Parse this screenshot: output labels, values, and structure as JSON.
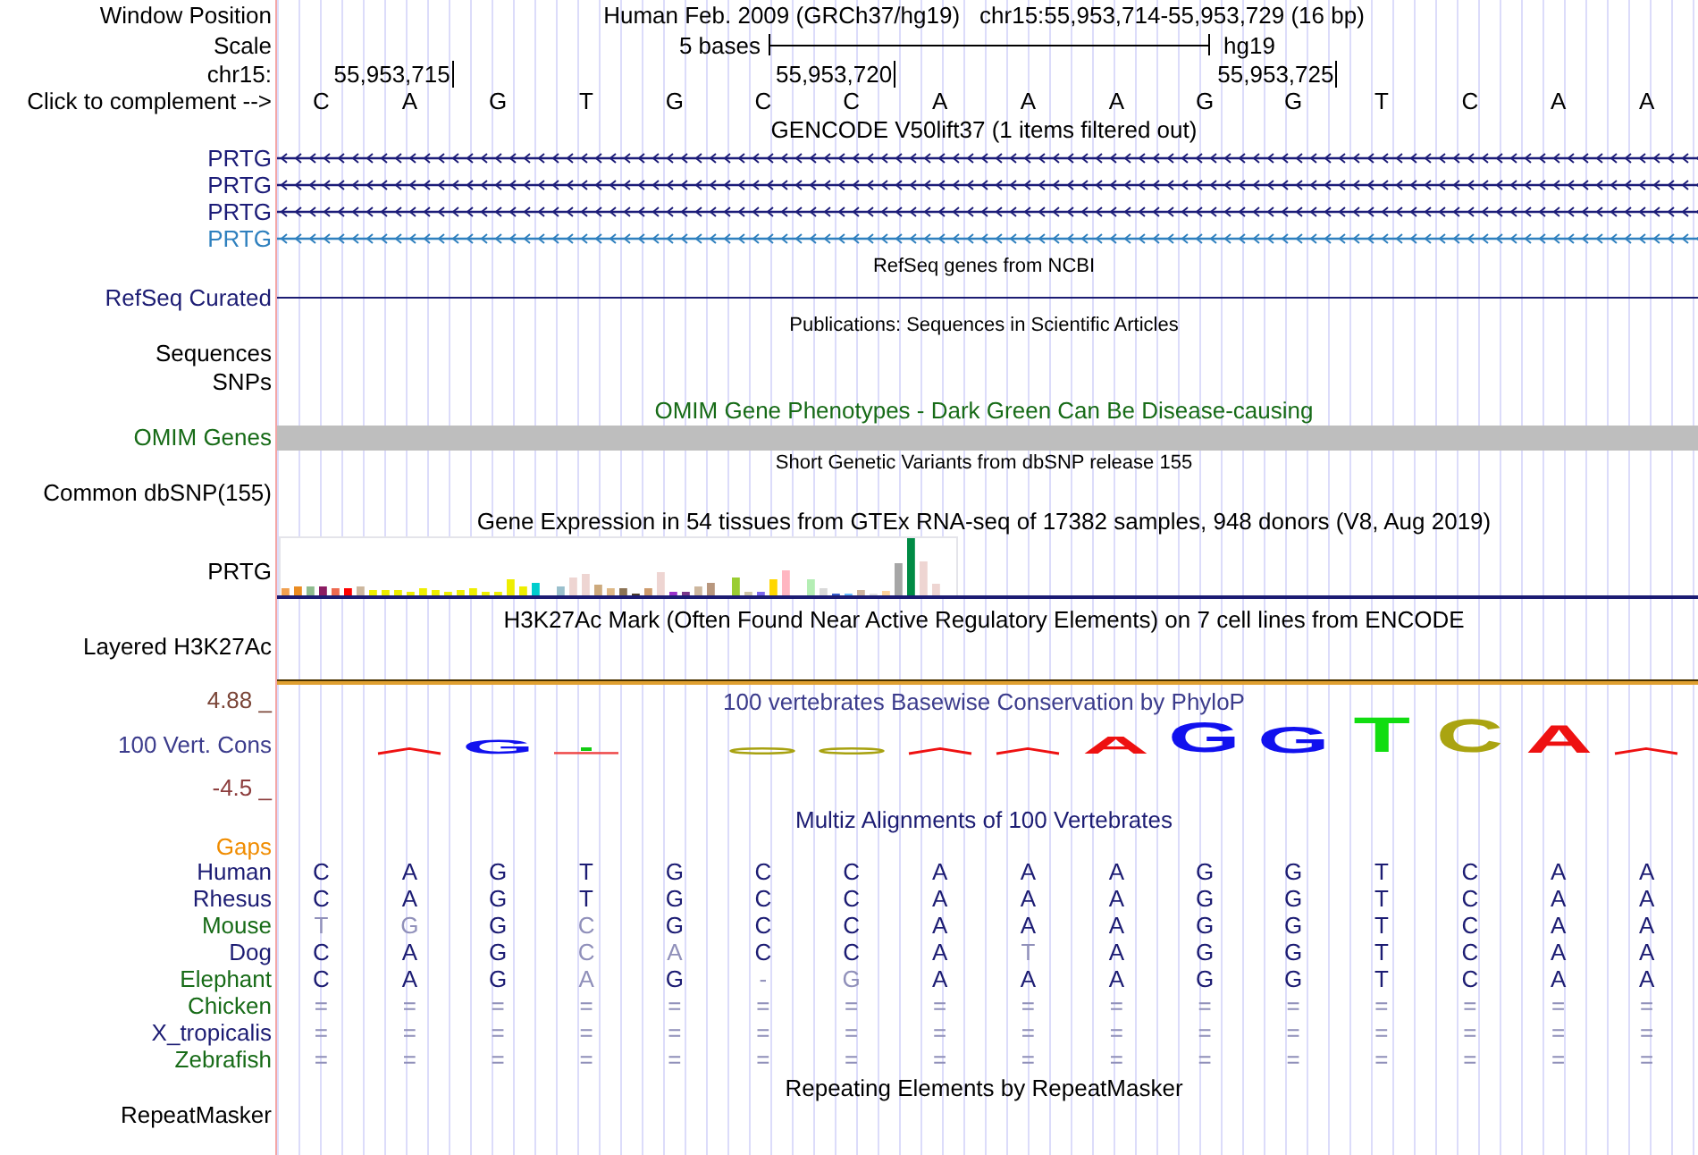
{
  "position_row": {
    "label": "Window Position",
    "titles": [
      "Human Feb. 2009 (GRCh37/hg19)",
      "chr15:55,953,714-55,953,729 (16 bp)"
    ]
  },
  "scale_row": {
    "label": "Scale",
    "span": "5 bases",
    "assembly": "hg19"
  },
  "coordinate_row": {
    "label": "chr15:",
    "positions": [
      "55,953,715",
      "55,953,720",
      "55,953,725"
    ]
  },
  "sequence_row": {
    "label": "Click to complement -->",
    "bases": [
      "C",
      "A",
      "G",
      "T",
      "G",
      "C",
      "C",
      "A",
      "A",
      "A",
      "G",
      "G",
      "T",
      "C",
      "A",
      "A"
    ]
  },
  "gencode": {
    "title": "GENCODE V50lift37 (1 items filtered out)",
    "transcripts": [
      {
        "label": "PRTG",
        "color": "#1c1c78"
      },
      {
        "label": "PRTG",
        "color": "#1c1c78"
      },
      {
        "label": "PRTG",
        "color": "#1c1c78"
      },
      {
        "label": "PRTG",
        "color": "#2f80be"
      }
    ]
  },
  "refseq": {
    "title": "RefSeq genes from NCBI",
    "label": "RefSeq Curated"
  },
  "publications": {
    "title": "Publications: Sequences in Scientific Articles",
    "labels": [
      "Sequences",
      "SNPs"
    ]
  },
  "omim": {
    "title": "OMIM Gene Phenotypes - Dark Green Can Be Disease-causing",
    "label": "OMIM Genes"
  },
  "dbsnp": {
    "title": "Short Genetic Variants from dbSNP release 155",
    "label": "Common dbSNP(155)"
  },
  "gtex": {
    "title": "Gene Expression in 54 tissues from GTEx RNA-seq of 17382 samples, 948 donors (V8, Aug 2019)",
    "label": "PRTG"
  },
  "h3k27ac": {
    "title": "H3K27Ac Mark (Often Found Near Active Regulatory Elements) on 7 cell lines from ENCODE",
    "label": "Layered H3K27Ac"
  },
  "conservation": {
    "title": "100 vertebrates Basewise Conservation by PhyloP",
    "max_label": "4.88 _",
    "label": "100 Vert. Cons",
    "min_label": "-4.5 _",
    "logo": [
      {
        "base": "G",
        "color": "#1111ee"
      },
      {
        "base": "A",
        "color": "#ee1111"
      },
      {
        "base": "G",
        "color": "#1111ee"
      },
      {
        "base": "G",
        "color": "#1111ee"
      },
      {
        "base": "T",
        "color": "#11dd11"
      },
      {
        "base": "C",
        "color": "#aaa411"
      },
      {
        "base": "A",
        "color": "#ee1111"
      }
    ]
  },
  "multiz": {
    "title": "Multiz Alignments of 100 Vertebrates",
    "gaps_label": "Gaps",
    "species": [
      {
        "name": "Human",
        "color": "#1c1c73",
        "bases": [
          {
            "base": "C",
            "match": true
          },
          {
            "base": "A",
            "match": true
          },
          {
            "base": "G",
            "match": true
          },
          {
            "base": "T",
            "match": true
          },
          {
            "base": "G",
            "match": true
          },
          {
            "base": "C",
            "match": true
          },
          {
            "base": "C",
            "match": true
          },
          {
            "base": "A",
            "match": true
          },
          {
            "base": "A",
            "match": true
          },
          {
            "base": "A",
            "match": true
          },
          {
            "base": "G",
            "match": true
          },
          {
            "base": "G",
            "match": true
          },
          {
            "base": "T",
            "match": true
          },
          {
            "base": "C",
            "match": true
          },
          {
            "base": "A",
            "match": true
          },
          {
            "base": "A",
            "match": true
          }
        ]
      },
      {
        "name": "Rhesus",
        "color": "#1c1c73",
        "bases": [
          {
            "base": "C",
            "match": true
          },
          {
            "base": "A",
            "match": true
          },
          {
            "base": "G",
            "match": true
          },
          {
            "base": "T",
            "match": true
          },
          {
            "base": "G",
            "match": true
          },
          {
            "base": "C",
            "match": true
          },
          {
            "base": "C",
            "match": true
          },
          {
            "base": "A",
            "match": true
          },
          {
            "base": "A",
            "match": true
          },
          {
            "base": "A",
            "match": true
          },
          {
            "base": "G",
            "match": true
          },
          {
            "base": "G",
            "match": true
          },
          {
            "base": "T",
            "match": true
          },
          {
            "base": "C",
            "match": true
          },
          {
            "base": "A",
            "match": true
          },
          {
            "base": "A",
            "match": true
          }
        ]
      },
      {
        "name": "Mouse",
        "color": "#176b17",
        "bases": [
          {
            "base": "T",
            "match": false
          },
          {
            "base": "G",
            "match": false
          },
          {
            "base": "G",
            "match": true
          },
          {
            "base": "C",
            "match": false
          },
          {
            "base": "G",
            "match": true
          },
          {
            "base": "C",
            "match": true
          },
          {
            "base": "C",
            "match": true
          },
          {
            "base": "A",
            "match": true
          },
          {
            "base": "A",
            "match": true
          },
          {
            "base": "A",
            "match": true
          },
          {
            "base": "G",
            "match": true
          },
          {
            "base": "G",
            "match": true
          },
          {
            "base": "T",
            "match": true
          },
          {
            "base": "C",
            "match": true
          },
          {
            "base": "A",
            "match": true
          },
          {
            "base": "A",
            "match": true
          }
        ]
      },
      {
        "name": "Dog",
        "color": "#1c1c73",
        "bases": [
          {
            "base": "C",
            "match": true
          },
          {
            "base": "A",
            "match": true
          },
          {
            "base": "G",
            "match": true
          },
          {
            "base": "C",
            "match": false
          },
          {
            "base": "A",
            "match": false
          },
          {
            "base": "C",
            "match": true
          },
          {
            "base": "C",
            "match": true
          },
          {
            "base": "A",
            "match": true
          },
          {
            "base": "T",
            "match": false
          },
          {
            "base": "A",
            "match": true
          },
          {
            "base": "G",
            "match": true
          },
          {
            "base": "G",
            "match": true
          },
          {
            "base": "T",
            "match": true
          },
          {
            "base": "C",
            "match": true
          },
          {
            "base": "A",
            "match": true
          },
          {
            "base": "A",
            "match": true
          }
        ]
      },
      {
        "name": "Elephant",
        "color": "#176b17",
        "bases": [
          {
            "base": "C",
            "match": true
          },
          {
            "base": "A",
            "match": true
          },
          {
            "base": "G",
            "match": true
          },
          {
            "base": "A",
            "match": false
          },
          {
            "base": "G",
            "match": true
          },
          {
            "base": "-",
            "match": false
          },
          {
            "base": "G",
            "match": false
          },
          {
            "base": "A",
            "match": true
          },
          {
            "base": "A",
            "match": true
          },
          {
            "base": "A",
            "match": true
          },
          {
            "base": "G",
            "match": true
          },
          {
            "base": "G",
            "match": true
          },
          {
            "base": "T",
            "match": true
          },
          {
            "base": "C",
            "match": true
          },
          {
            "base": "A",
            "match": true
          },
          {
            "base": "A",
            "match": true
          }
        ]
      },
      {
        "name": "Chicken",
        "color": "#176b17",
        "bases": [
          {
            "base": "=",
            "match": false
          },
          {
            "base": "=",
            "match": false
          },
          {
            "base": "=",
            "match": false
          },
          {
            "base": "=",
            "match": false
          },
          {
            "base": "=",
            "match": false
          },
          {
            "base": "=",
            "match": false
          },
          {
            "base": "=",
            "match": false
          },
          {
            "base": "=",
            "match": false
          },
          {
            "base": "=",
            "match": false
          },
          {
            "base": "=",
            "match": false
          },
          {
            "base": "=",
            "match": false
          },
          {
            "base": "=",
            "match": false
          },
          {
            "base": "=",
            "match": false
          },
          {
            "base": "=",
            "match": false
          },
          {
            "base": "=",
            "match": false
          },
          {
            "base": "=",
            "match": false
          }
        ]
      },
      {
        "name": "X_tropicalis",
        "color": "#1c1c73",
        "bases": [
          {
            "base": "=",
            "match": false
          },
          {
            "base": "=",
            "match": false
          },
          {
            "base": "=",
            "match": false
          },
          {
            "base": "=",
            "match": false
          },
          {
            "base": "=",
            "match": false
          },
          {
            "base": "=",
            "match": false
          },
          {
            "base": "=",
            "match": false
          },
          {
            "base": "=",
            "match": false
          },
          {
            "base": "=",
            "match": false
          },
          {
            "base": "=",
            "match": false
          },
          {
            "base": "=",
            "match": false
          },
          {
            "base": "=",
            "match": false
          },
          {
            "base": "=",
            "match": false
          },
          {
            "base": "=",
            "match": false
          },
          {
            "base": "=",
            "match": false
          },
          {
            "base": "=",
            "match": false
          }
        ]
      },
      {
        "name": "Zebrafish",
        "color": "#176b17",
        "bases": [
          {
            "base": "=",
            "match": false
          },
          {
            "base": "=",
            "match": false
          },
          {
            "base": "=",
            "match": false
          },
          {
            "base": "=",
            "match": false
          },
          {
            "base": "=",
            "match": false
          },
          {
            "base": "=",
            "match": false
          },
          {
            "base": "=",
            "match": false
          },
          {
            "base": "=",
            "match": false
          },
          {
            "base": "=",
            "match": false
          },
          {
            "base": "=",
            "match": false
          },
          {
            "base": "=",
            "match": false
          },
          {
            "base": "=",
            "match": false
          },
          {
            "base": "=",
            "match": false
          },
          {
            "base": "=",
            "match": false
          },
          {
            "base": "=",
            "match": false
          },
          {
            "base": "=",
            "match": false
          }
        ]
      }
    ]
  },
  "repeatmasker": {
    "title": "Repeating Elements by RepeatMasker",
    "label": "RepeatMasker"
  }
}
